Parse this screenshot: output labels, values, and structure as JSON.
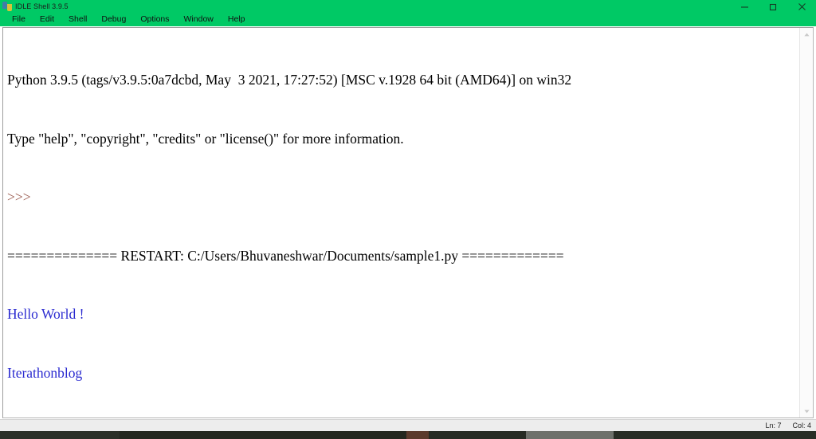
{
  "window": {
    "title": "IDLE Shell 3.9.5",
    "icon": "python-icon",
    "titlebar_color": "#00c965",
    "controls": {
      "minimize": "Minimize",
      "maximize": "Restore",
      "close": "Close"
    }
  },
  "menubar": {
    "items": [
      {
        "label": "File"
      },
      {
        "label": "Edit"
      },
      {
        "label": "Shell"
      },
      {
        "label": "Debug"
      },
      {
        "label": "Options"
      },
      {
        "label": "Window"
      },
      {
        "label": "Help"
      }
    ]
  },
  "shell": {
    "colors": {
      "output": "#2a2ad0",
      "prompt": "#9a5a4e",
      "text": "#000000"
    },
    "lines": [
      {
        "id": "banner-version",
        "text": "Python 3.9.5 (tags/v3.9.5:0a7dcbd, May  3 2021, 17:27:52) [MSC v.1928 64 bit (AMD64)] on win32",
        "style": "plain"
      },
      {
        "id": "banner-help",
        "text": "Type \"help\", \"copyright\", \"credits\" or \"license()\" for more information.",
        "style": "plain"
      },
      {
        "id": "prompt-1",
        "text": ">>> ",
        "style": "prompt"
      },
      {
        "id": "restart-separator",
        "text": "============== RESTART: C:/Users/Bhuvaneshwar/Documents/sample1.py =============",
        "style": "plain"
      },
      {
        "id": "output-1",
        "text": "Hello World !",
        "style": "output"
      },
      {
        "id": "output-2",
        "text": "Iterathonblog",
        "style": "output"
      },
      {
        "id": "prompt-2",
        "text": ">>> ",
        "style": "prompt"
      }
    ]
  },
  "statusbar": {
    "line_label": "Ln: 7",
    "col_label": "Col: 4"
  }
}
